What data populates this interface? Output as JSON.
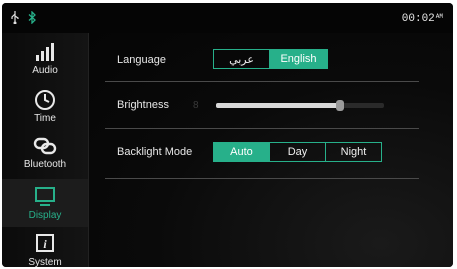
{
  "status": {
    "usb_icon": "usb-icon",
    "bluetooth_icon": "bluetooth-icon",
    "time": "00:02",
    "ampm": "AM"
  },
  "sidebar": {
    "items": [
      {
        "label": "Audio",
        "icon": "audio-bars-icon",
        "active": false
      },
      {
        "label": "Time",
        "icon": "clock-icon",
        "active": false
      },
      {
        "label": "Bluetooth",
        "icon": "link-icon",
        "active": false
      },
      {
        "label": "Display",
        "icon": "monitor-icon",
        "active": true
      },
      {
        "label": "System",
        "icon": "info-icon",
        "active": false
      }
    ]
  },
  "settings": {
    "language": {
      "label": "Language",
      "options": [
        "عربي",
        "English"
      ],
      "selected": "English"
    },
    "brightness": {
      "label": "Brightness",
      "value": "8",
      "level_fraction": 0.74
    },
    "backlight": {
      "label": "Backlight Mode",
      "options": [
        "Auto",
        "Day",
        "Night"
      ],
      "selected": "Auto"
    }
  },
  "colors": {
    "accent": "#27b08a",
    "background": "#000000",
    "text": "#e8e8e8"
  }
}
